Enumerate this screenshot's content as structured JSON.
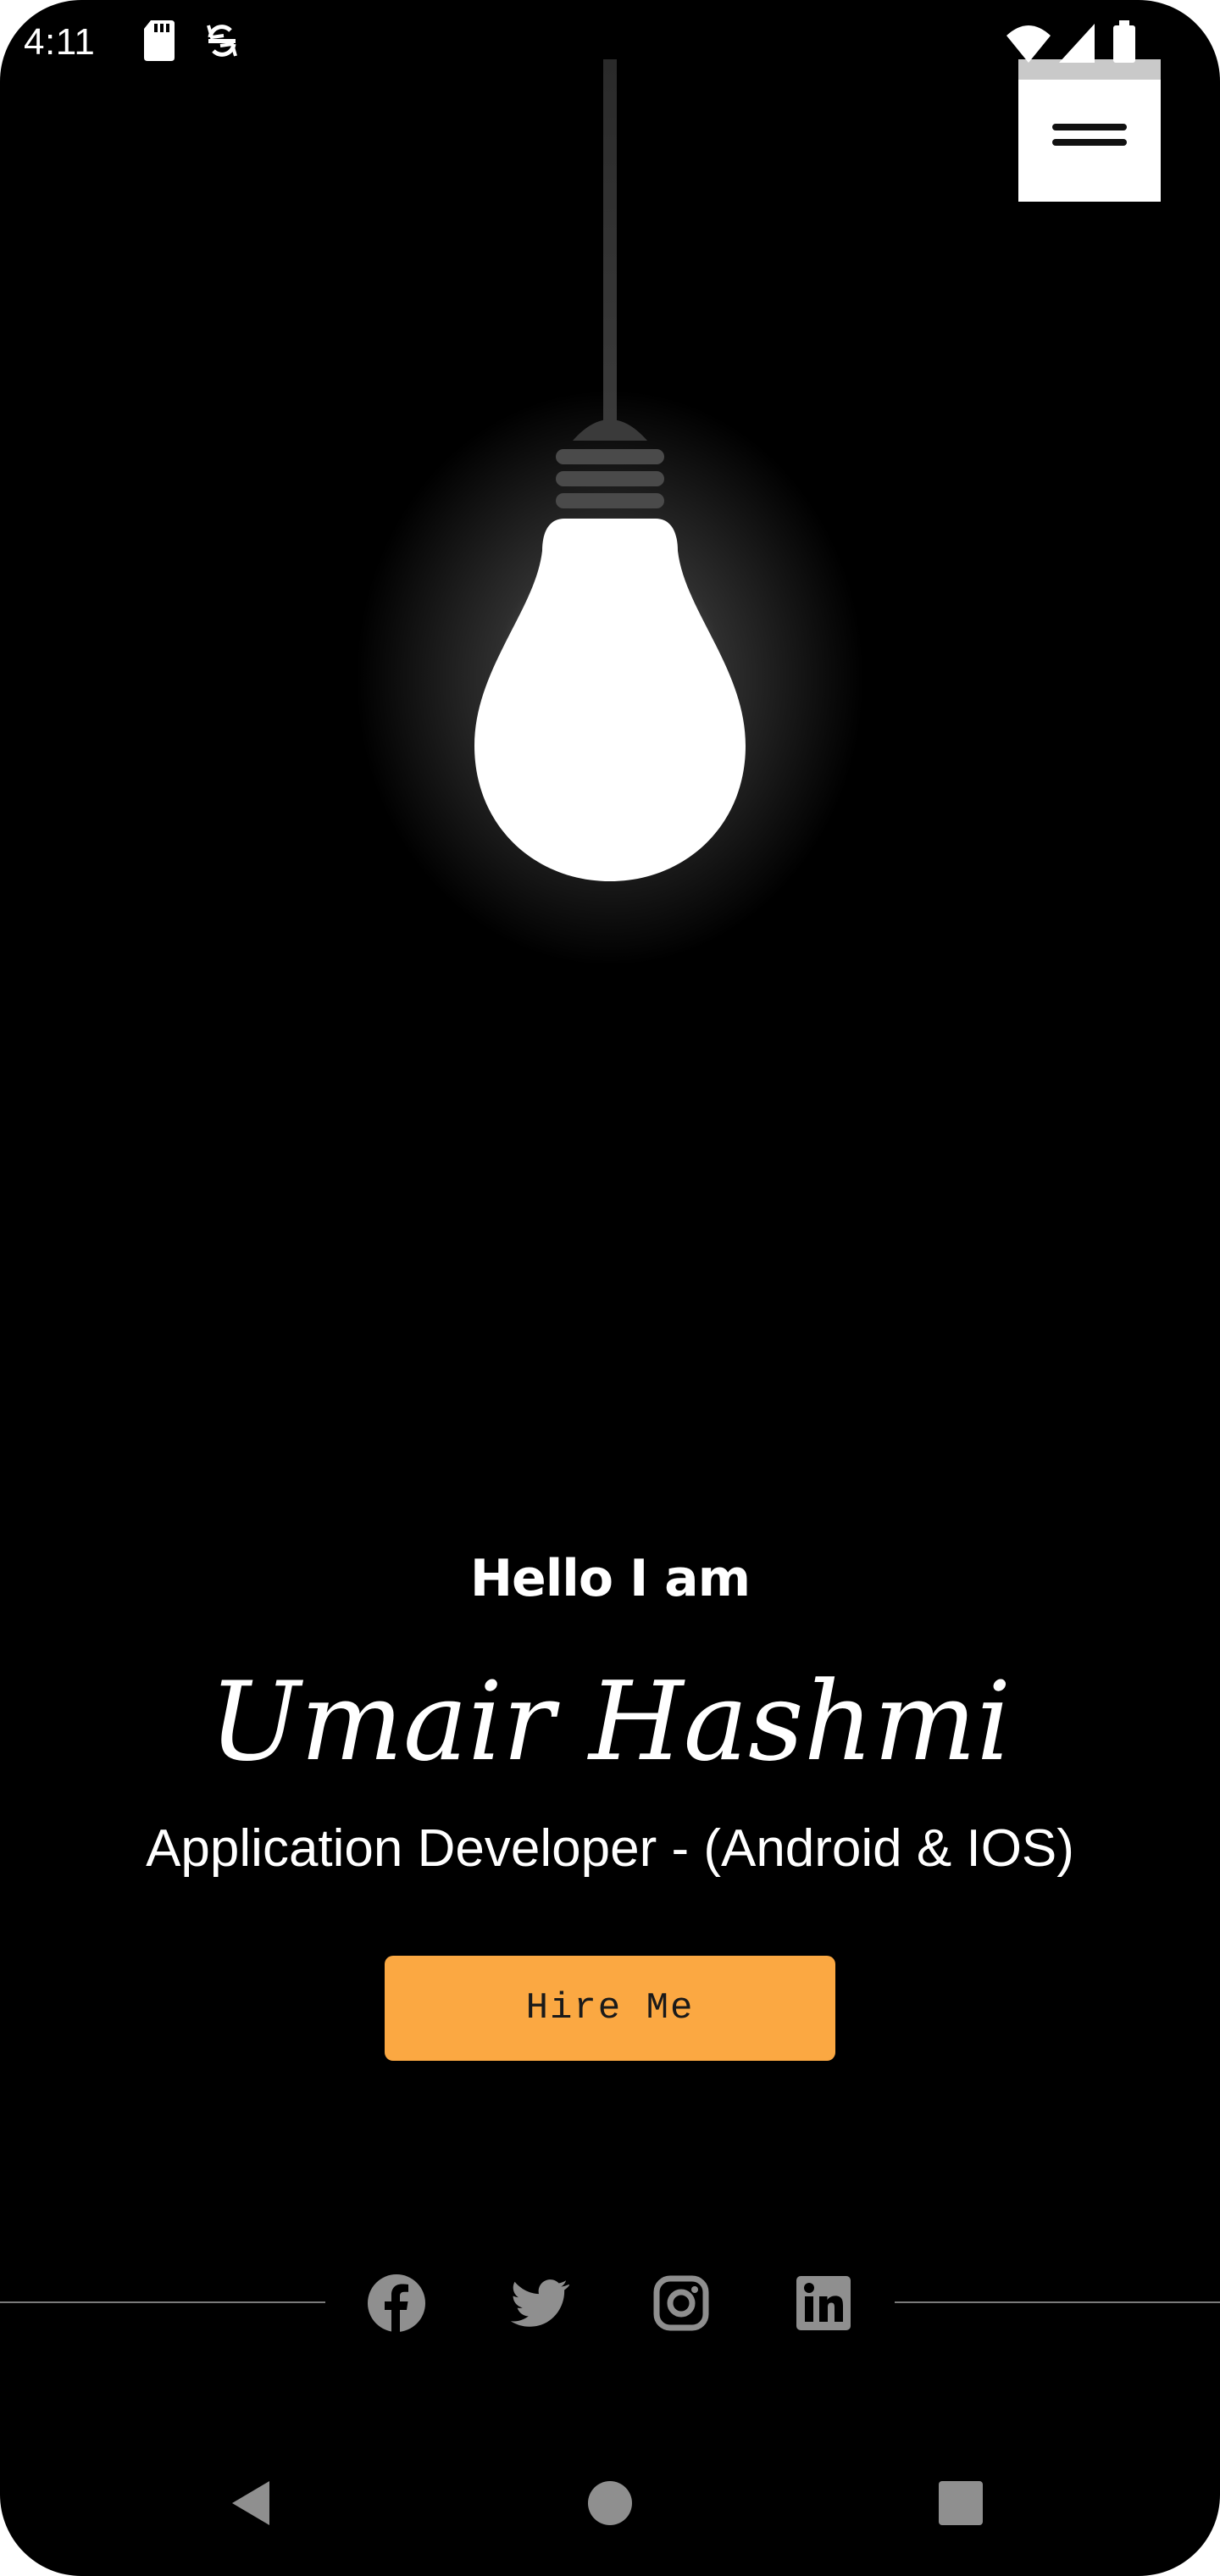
{
  "status_bar": {
    "time": "4:11",
    "icons": [
      "sd-card-icon",
      "sync-icon",
      "wifi-icon",
      "signal-icon",
      "battery-icon"
    ]
  },
  "header": {
    "menu_icon": "hamburger-menu-icon"
  },
  "hero": {
    "illustration": "lightbulb-icon",
    "greeting": "Hello I am",
    "name": "Umair Hashmi",
    "role": "Application Developer - (Android & IOS)",
    "cta_label": "Hire Me"
  },
  "social": {
    "links": [
      {
        "name": "facebook",
        "icon": "facebook-icon"
      },
      {
        "name": "twitter",
        "icon": "twitter-icon"
      },
      {
        "name": "instagram",
        "icon": "instagram-icon"
      },
      {
        "name": "linkedin",
        "icon": "linkedin-icon"
      }
    ]
  },
  "nav_bar": {
    "buttons": [
      "back-icon",
      "home-icon",
      "recents-icon"
    ]
  },
  "colors": {
    "background": "#000000",
    "accent": "#fba842",
    "text": "#ffffff",
    "icon_gray": "#8f8f8f",
    "menu_button": "#ffffff"
  }
}
